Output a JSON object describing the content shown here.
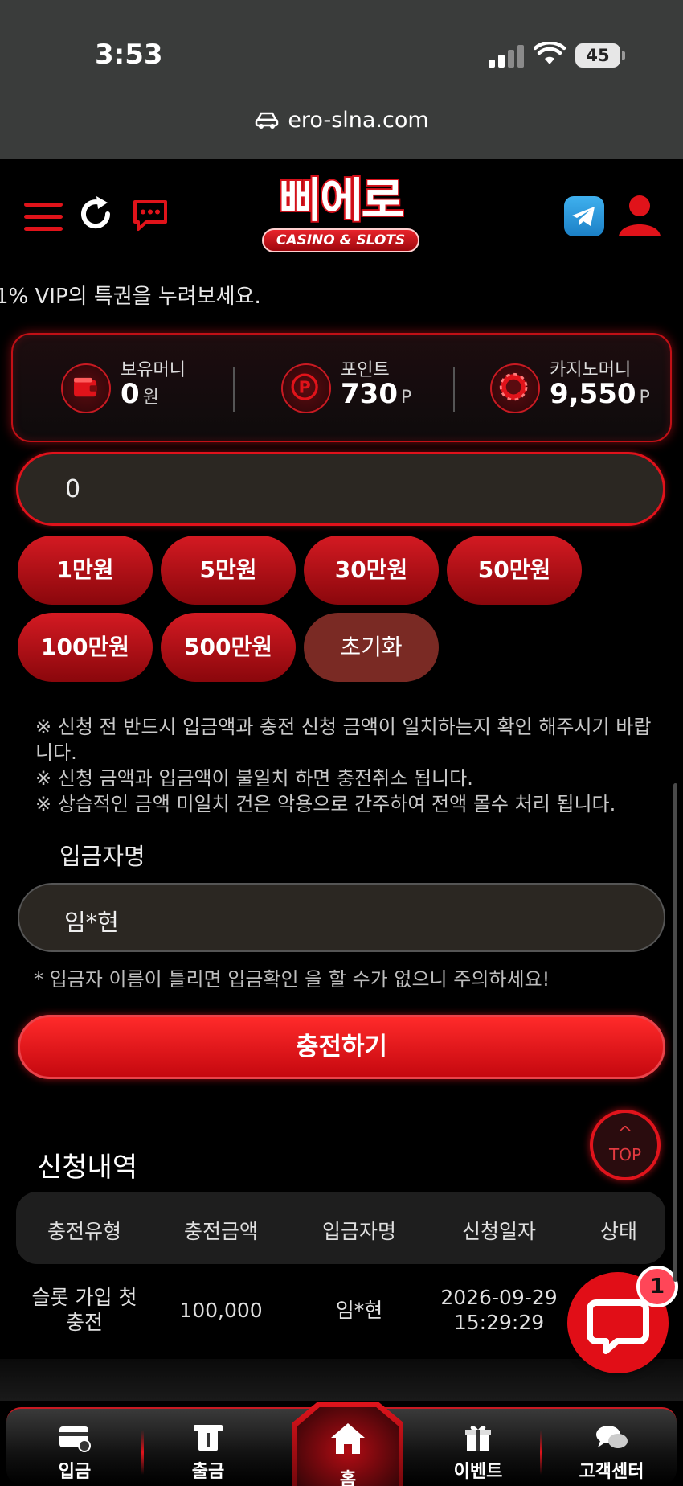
{
  "status_bar": {
    "time": "3:53",
    "battery": "45"
  },
  "browser": {
    "url": "ero-slna.com"
  },
  "header": {
    "logo_main": "삐에로",
    "logo_sub": "CASINO & SLOTS"
  },
  "marquee": "1% VIP의 특권을 누려보세요.",
  "balance": {
    "money": {
      "label": "보유머니",
      "value": "0",
      "unit": "원"
    },
    "points": {
      "label": "포인트",
      "value": "730",
      "unit": "P"
    },
    "casino": {
      "label": "카지노머니",
      "value": "9,550",
      "unit": "P"
    }
  },
  "deposit": {
    "amount_value": "0",
    "chips": [
      "1만원",
      "5만원",
      "30만원",
      "50만원",
      "100만원",
      "500만원"
    ],
    "reset_label": "초기화",
    "notes": [
      "※ 신청 전 반드시 입금액과 충전 신청 금액이 일치하는지 확인 해주시기 바랍니다.",
      "※ 신청 금액과 입금액이 불일치 하면 충전취소 됩니다.",
      "※ 상습적인 금액 미일치 건은 악용으로 간주하여 전액 몰수 처리 됩니다."
    ],
    "depositor_label": "입금자명",
    "depositor_value": "임*현",
    "warning": "* 입금자 이름이 틀리면 입금확인 을 할 수가 없으니 주의하세요!",
    "submit_label": "충전하기"
  },
  "top_button": {
    "label": "TOP"
  },
  "history": {
    "title": "신청내역",
    "columns": [
      "충전유형",
      "충전금액",
      "입금자명",
      "신청일자",
      "상태"
    ],
    "rows": [
      {
        "type_line1": "슬롯 가입 첫",
        "type_line2": "충전",
        "amount": "100,000",
        "name": "임*현",
        "date": "2026-09-29",
        "time": "15:29:29"
      }
    ]
  },
  "chat_fab": {
    "badge": "1"
  },
  "bottom_nav": {
    "deposit": "입금",
    "withdraw": "출금",
    "home": "홈",
    "event": "이벤트",
    "support": "고객센터"
  },
  "colors": {
    "accent": "#e0131a",
    "background": "#000000",
    "input_bg": "#2b2722"
  }
}
